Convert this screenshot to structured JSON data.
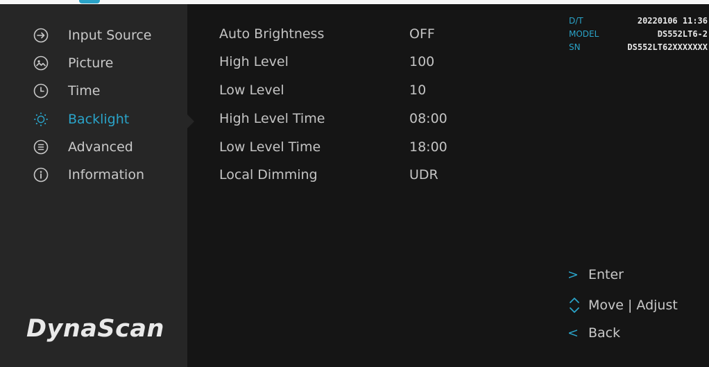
{
  "menu": {
    "items": [
      {
        "label": "Input Source",
        "icon": "input-source-icon"
      },
      {
        "label": "Picture",
        "icon": "picture-icon"
      },
      {
        "label": "Time",
        "icon": "clock-icon"
      },
      {
        "label": "Backlight",
        "icon": "sun-icon",
        "active": true
      },
      {
        "label": "Advanced",
        "icon": "advanced-list-icon"
      },
      {
        "label": "Information",
        "icon": "info-icon"
      }
    ]
  },
  "logo": "DynaScan",
  "settings": [
    {
      "label": "Auto Brightness",
      "value": "OFF"
    },
    {
      "label": "High Level",
      "value": "100"
    },
    {
      "label": "Low Level",
      "value": "10"
    },
    {
      "label": "High Level Time",
      "value": "08:00"
    },
    {
      "label": "Low Level Time",
      "value": "18:00"
    },
    {
      "label": "Local Dimming",
      "value": "UDR"
    }
  ],
  "info": {
    "dt_label": "D/T",
    "dt_value": "20220106 11:36",
    "model_label": "MODEL",
    "model_value": "DS552LT6-2",
    "sn_label": "SN",
    "sn_value": "DS552LT62XXXXXXX"
  },
  "help": {
    "enter_symbol": ">",
    "enter": "Enter",
    "move_adjust": "Move | Adjust",
    "back_symbol": "<",
    "back": "Back"
  },
  "colors": {
    "accent": "#2aa3c8",
    "sidebar": "#262626",
    "background": "#151515"
  }
}
